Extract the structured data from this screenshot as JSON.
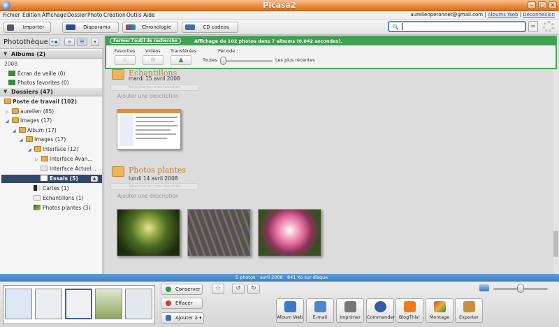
{
  "window": {
    "title": "Picasa2"
  },
  "menu": [
    "Fichier",
    "Édition",
    "Affichage",
    "Dossier",
    "Photo",
    "Création",
    "Outils",
    "Aide"
  ],
  "account": {
    "email": "aurelienperonnet@gmail.com",
    "sep": "|",
    "albums_web": "Albums Web",
    "deconnexion": "Déconnexion"
  },
  "toolbar": {
    "import": "Importer",
    "slideshow": "Diaporama",
    "timeline": "Chronologie",
    "gift_cd": "CD cadeau"
  },
  "search": {
    "value": "",
    "placeholder": ""
  },
  "library": {
    "title": "Photothèque",
    "albums_header": "Albums (2)",
    "year": "2008",
    "albums": [
      {
        "label": "Écran de veille (0)",
        "icon": "screensaver-icon"
      },
      {
        "label": "Photos favorites (0)",
        "icon": "starred-photos-icon"
      }
    ],
    "folders_header": "Dossiers (47)",
    "tree": [
      {
        "label": "Poste de travail (102)",
        "bold": true
      },
      {
        "label": "aurelien (85)"
      },
      {
        "label": "Images (17)"
      },
      {
        "label": "Album (17)"
      },
      {
        "label": "Images (17)"
      },
      {
        "label": "Interface (12)"
      },
      {
        "label": "Interface Avan..."
      },
      {
        "label": "Interface Actuel..."
      },
      {
        "label": "Essais (5)",
        "selected": true
      },
      {
        "label": "Cartes (1)"
      },
      {
        "label": "Echantillons (1)"
      },
      {
        "label": "Photos plantes (3)"
      }
    ]
  },
  "search_panel": {
    "close_label": "Fermer l'outil de recherche",
    "result": "Affichage de 102 photos dans 7 albums (0,042 secondes).",
    "favorites": "Favorites",
    "videos": "Vidéos",
    "uploaded": "Transférées",
    "period": "Période :",
    "all": "Toutes",
    "most_recent": "Les plus récentes"
  },
  "albums": [
    {
      "title": "Echantillons",
      "date": "mardi 15 avril 2008",
      "select": "Sélectionner mes favorites",
      "desc": "Ajouter une description"
    },
    {
      "title": "Photos plantes",
      "date": "lundi 14 avril 2008",
      "select": "Sélectionner mes favorites",
      "desc": "Ajouter une description"
    }
  ],
  "status": {
    "photos": "5 photos",
    "date": "avril 2008",
    "size": "841 Ko sur disque"
  },
  "bottom": {
    "keep": "Conserver",
    "clear": "Effacer",
    "add_to": "Ajouter à",
    "export_buttons": [
      {
        "label": "Album Web",
        "icon": "web-album-icon",
        "color": "#3b78c8"
      },
      {
        "label": "E-mail",
        "icon": "email-icon",
        "color": "#4f86c9"
      },
      {
        "label": "Imprimer",
        "icon": "printer-icon",
        "color": "#777777"
      },
      {
        "label": "Commander",
        "icon": "order-icon",
        "color": "#2f5fa8"
      },
      {
        "label": "BlogThis!",
        "icon": "blogger-icon",
        "color": "#f07b1c"
      },
      {
        "label": "Montage",
        "icon": "collage-icon",
        "color": "#c84a32"
      },
      {
        "label": "Exporter",
        "icon": "export-icon",
        "color": "#c89138"
      }
    ]
  },
  "colors": {
    "accent": "#e88a3e",
    "search_green": "#3f9f52",
    "status_blue": "#3e7fbd",
    "selection": "#34496a"
  }
}
